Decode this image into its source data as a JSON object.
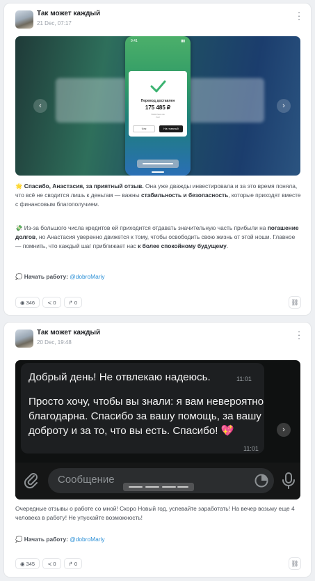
{
  "posts": [
    {
      "author": "Так может каждый",
      "date": "21 Dec, 07:17",
      "screenshot": {
        "status_time": "9:41",
        "card_title": "Перевод доставлен",
        "amount": "175 485 ₽",
        "sub_line1": "Зачислено на",
        "sub_line2": "счет",
        "btn_check": "Чек",
        "btn_done": "На главный"
      },
      "p1": {
        "emoji": "🌟",
        "lead": "Спасибо, Анастасия, за приятный отзыв.",
        "t1": " Она уже дважды инвестировала и за это время поняла, что всё не сводится лишь к деньгам — важны ",
        "b1": "стабильность и безопасность",
        "t2": ", которые приходят вместе с финансовым благополучием."
      },
      "p2": {
        "emoji": "💸",
        "t1": " Из-за большого числа кредитов ей приходится отдавать значительную часть прибыли на ",
        "b1": "погашение долгов",
        "t2": ", но Анастасия уверенно движется к тому, чтобы освободить свою жизнь от этой ноши. Главное — помнить, что каждый шаг приближает нас ",
        "b2": "к более спокойному будущему",
        "t3": "."
      },
      "start_emoji": "💭",
      "start_label": "Начать работу:",
      "start_link": "@dobroMariy",
      "stats": {
        "views": "346",
        "shares": "0",
        "reposts": "0"
      }
    },
    {
      "author": "Так может каждый",
      "date": "20 Dec, 19:48",
      "chat": {
        "msg1": "Добрый день! Не отвлекаю надеюсь.",
        "time1": "11:01",
        "msg2": "Просто хочу, чтобы вы знали: я вам невероятно благодарна. Спасибо за вашу помощь, за вашу доброту и за то, что вы есть. Спасибо! 💖",
        "time2": "11:01",
        "placeholder": "Сообщение"
      },
      "text": "Очередные отзывы о работе со мной! Скоро Новый год, успевайте заработать! На вечер возьму еще 4 человека в работу! Не упускайте возможность!",
      "start_emoji": "💭",
      "start_label": "Начать работу:",
      "start_link": "@dobroMariy",
      "stats": {
        "views": "345",
        "shares": "0",
        "reposts": "0"
      }
    }
  ],
  "icons": {
    "views": "eye-icon",
    "shares": "share-icon",
    "reposts": "repost-icon",
    "link": "link-icon"
  },
  "colors": {
    "link": "#2a8fd6",
    "card_bg": "#ffffff",
    "page_bg": "#eef0f3"
  }
}
